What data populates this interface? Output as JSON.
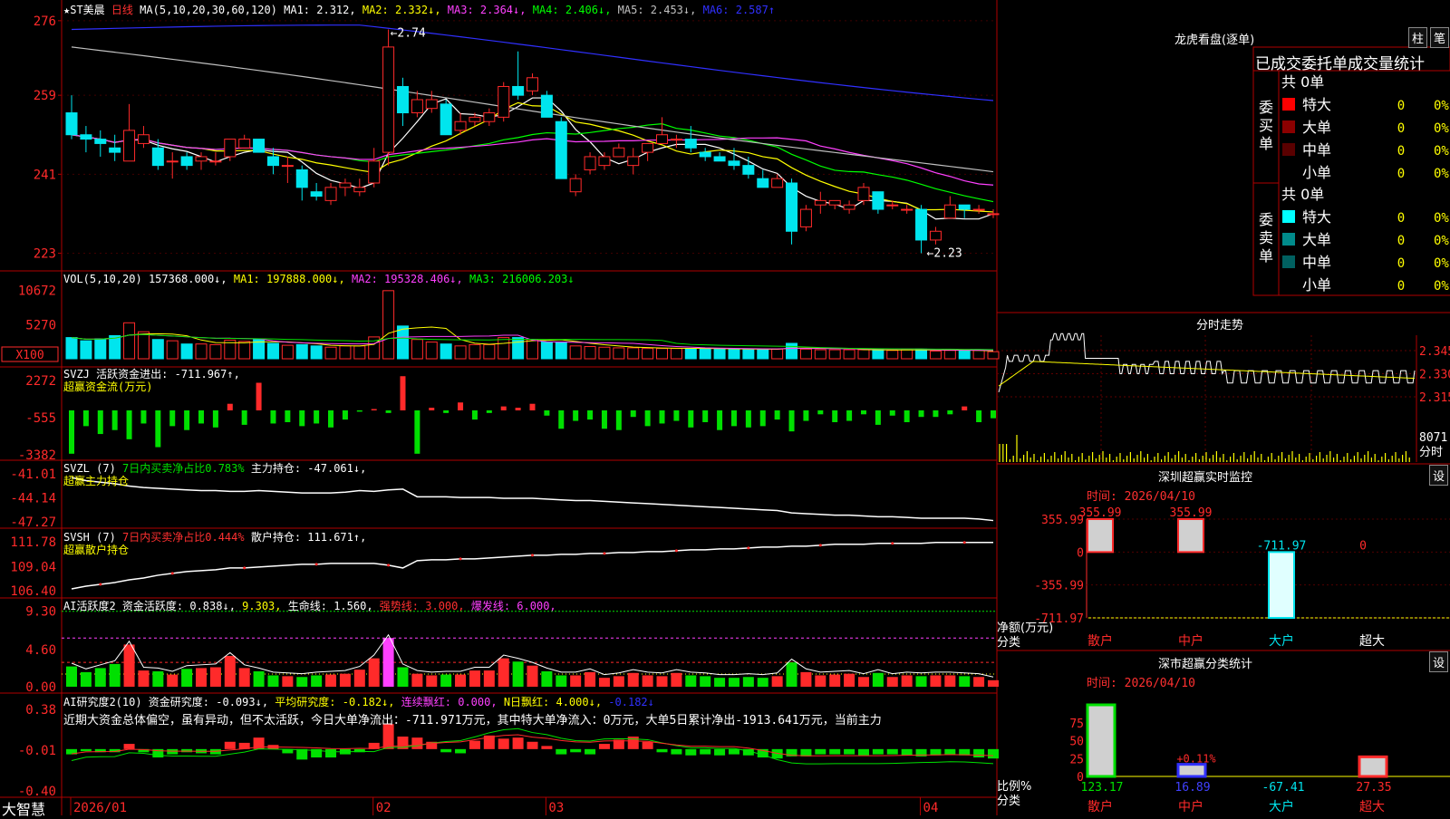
{
  "colors": {
    "up": "#ff2a2a",
    "down": "#00e5ee",
    "grid": "#b00000",
    "ma1": "#ffffff",
    "ma2": "#ffff00",
    "ma3": "#ff40ff",
    "ma4": "#00ff00",
    "ma5": "#c0c0c0",
    "ma6": "#3030ff",
    "green": "#00e000",
    "yellow": "#ffff00",
    "magenta": "#ff40ff",
    "orange": "#ff8040"
  },
  "header": {
    "star": "★",
    "symbol": "ST美晨",
    "period": "日线",
    "ma_label": "MA(5,10,20,30,60,120)",
    "ma1": "MA1: 2.312,",
    "ma2": "MA2: 2.332↓,",
    "ma3": "MA3: 2.364↓,",
    "ma4": "MA4: 2.406↓,",
    "ma5": "MA5: 2.453↓,",
    "ma6": "MA6: 2.587↑"
  },
  "price_axis": [
    "276",
    "259",
    "241",
    "223"
  ],
  "price_annotations": {
    "high": "←2.74",
    "low": "←2.23"
  },
  "vol": {
    "label": "VOL(5,10,20)",
    "value": "157368.000↓,",
    "ma1": "MA1: 197888.000↓,",
    "ma2": "MA2: 195328.406↓,",
    "ma3": "MA3: 216006.203↓",
    "axis": [
      "10672",
      "5270"
    ],
    "unit": "X100"
  },
  "svzj": {
    "label": "SVZJ  活跃资金进出: -711.967↑,",
    "sub": "超赢资金流(万元)",
    "axis": [
      "2272",
      "-555",
      "-3382"
    ]
  },
  "svzl": {
    "label1": "SVZL (7)",
    "label2": "7日内买卖净占比0.783%",
    "label3": "主力持仓: -47.061↓,",
    "sub": "超赢主力持仓",
    "axis": [
      "-41.01",
      "-44.14",
      "-47.27"
    ]
  },
  "svsh": {
    "label1": "SVSH (7)",
    "label2": "7日内买卖净占比0.444%",
    "label3": "散户持仓: 111.671↑,",
    "sub": "超赢散户持仓",
    "axis": [
      "111.78",
      "109.04",
      "106.40"
    ]
  },
  "ai1": {
    "label1": "AI活跃度2 资金活跃度: 0.838↓,",
    "label2": "9.303,",
    "label3": "生命线: 1.560,",
    "label4": "强势线: 3.000,",
    "label5": "爆发线: 6.000,",
    "axis": [
      "9.30",
      "4.60",
      "0.00"
    ]
  },
  "ai2": {
    "label1": "AI研究度2(10) 资金研究度: -0.093↓,",
    "label2": "平均研究度: -0.182↓,",
    "label3": "连续飘红: 0.000,",
    "label4": "N日飘红: 4.000↓,",
    "label5": "-0.182↓",
    "comment": "近期大资金总体偏空，虽有异动，但不太活跃，今日大单净流出：-711.971万元，其中特大单净流入：0万元，大单5日累计净出-1913.641万元，当前主力",
    "axis": [
      "0.38",
      "-0.01",
      "-0.40"
    ]
  },
  "date_axis": [
    "2026/01",
    "02",
    "03",
    "04"
  ],
  "brand": "大智慧",
  "right": {
    "lhb_title": "龙虎看盘(逐单)",
    "tab1": "柱",
    "tab2": "笔",
    "stats_header": "已成交委托单成交量统计",
    "buy_label": "委买单",
    "sell_label": "委卖单",
    "buy_total": "共 0单",
    "sell_total": "共 0单",
    "buy_rows": [
      {
        "name": "特大",
        "qty": "0",
        "pct": "0%",
        "color": "#ff0000"
      },
      {
        "name": "大单",
        "qty": "0",
        "pct": "0%",
        "color": "#8b0000"
      },
      {
        "name": "中单",
        "qty": "0",
        "pct": "0%",
        "color": "#5a0000"
      },
      {
        "name": "小单",
        "qty": "0",
        "pct": "0%",
        "color": ""
      }
    ],
    "sell_rows": [
      {
        "name": "特大",
        "qty": "0",
        "pct": "0%",
        "color": "#00ffff"
      },
      {
        "name": "大单",
        "qty": "0",
        "pct": "0%",
        "color": "#008b8b"
      },
      {
        "name": "中单",
        "qty": "0",
        "pct": "0%",
        "color": "#006060"
      },
      {
        "name": "小单",
        "qty": "0",
        "pct": "0%",
        "color": ""
      }
    ],
    "fs_title": "分时走势",
    "fs_axis": [
      "2.345",
      "2.330",
      "2.315"
    ],
    "fs_vol": "8071",
    "fs_vol_unit": "分时",
    "monitor_title": "深圳超赢实时监控",
    "monitor_btn": "设",
    "monitor_time": "时间: 2026/04/10",
    "monitor_axis": [
      "355.99",
      "0",
      "-355.99",
      "-711.97"
    ],
    "monitor_ylabel": "净额(万元)",
    "monitor_xlabel": "分类",
    "monitor_cats": [
      "散户",
      "中户",
      "大户",
      "超大"
    ],
    "monitor_vals": [
      "355.99",
      "355.99",
      "-711.97",
      "0"
    ],
    "stat_title": "深市超赢分类统计",
    "stat_btn": "设",
    "stat_time": "时间: 2026/04/10",
    "stat_axis": [
      "75",
      "50",
      "25",
      "0"
    ],
    "stat_ylabel": "比例%",
    "stat_xlabel": "分类",
    "stat_cats": [
      "散户",
      "中户",
      "大户",
      "超大"
    ],
    "stat_vals": [
      "123.17",
      "16.89",
      "-67.41",
      "27.35"
    ],
    "stat_note": "+0.11%"
  },
  "chart_data": {
    "type": "bar",
    "title": "ST美晨 日线",
    "candles": [
      {
        "o": 2.55,
        "h": 2.59,
        "l": 2.49,
        "c": 2.5
      },
      {
        "o": 2.5,
        "h": 2.52,
        "l": 2.46,
        "c": 2.49
      },
      {
        "o": 2.49,
        "h": 2.51,
        "l": 2.45,
        "c": 2.48
      },
      {
        "o": 2.47,
        "h": 2.5,
        "l": 2.44,
        "c": 2.46
      },
      {
        "o": 2.44,
        "h": 2.57,
        "l": 2.44,
        "c": 2.51
      },
      {
        "o": 2.48,
        "h": 2.52,
        "l": 2.47,
        "c": 2.5
      },
      {
        "o": 2.47,
        "h": 2.49,
        "l": 2.42,
        "c": 2.43
      },
      {
        "o": 2.44,
        "h": 2.46,
        "l": 2.4,
        "c": 2.44
      },
      {
        "o": 2.45,
        "h": 2.46,
        "l": 2.42,
        "c": 2.43
      },
      {
        "o": 2.44,
        "h": 2.46,
        "l": 2.42,
        "c": 2.45
      },
      {
        "o": 2.44,
        "h": 2.46,
        "l": 2.43,
        "c": 2.44
      },
      {
        "o": 2.45,
        "h": 2.49,
        "l": 2.44,
        "c": 2.49
      },
      {
        "o": 2.47,
        "h": 2.5,
        "l": 2.47,
        "c": 2.49
      },
      {
        "o": 2.49,
        "h": 2.49,
        "l": 2.46,
        "c": 2.46
      },
      {
        "o": 2.45,
        "h": 2.47,
        "l": 2.41,
        "c": 2.43
      },
      {
        "o": 2.43,
        "h": 2.45,
        "l": 2.39,
        "c": 2.43
      },
      {
        "o": 2.42,
        "h": 2.43,
        "l": 2.35,
        "c": 2.38
      },
      {
        "o": 2.37,
        "h": 2.39,
        "l": 2.35,
        "c": 2.36
      },
      {
        "o": 2.35,
        "h": 2.39,
        "l": 2.34,
        "c": 2.38
      },
      {
        "o": 2.38,
        "h": 2.4,
        "l": 2.36,
        "c": 2.39
      },
      {
        "o": 2.37,
        "h": 2.4,
        "l": 2.36,
        "c": 2.38
      },
      {
        "o": 2.39,
        "h": 2.47,
        "l": 2.38,
        "c": 2.44
      },
      {
        "o": 2.46,
        "h": 2.74,
        "l": 2.43,
        "c": 2.7
      },
      {
        "o": 2.61,
        "h": 2.63,
        "l": 2.52,
        "c": 2.55
      },
      {
        "o": 2.55,
        "h": 2.6,
        "l": 2.54,
        "c": 2.58
      },
      {
        "o": 2.56,
        "h": 2.6,
        "l": 2.55,
        "c": 2.58
      },
      {
        "o": 2.57,
        "h": 2.58,
        "l": 2.5,
        "c": 2.5
      },
      {
        "o": 2.51,
        "h": 2.55,
        "l": 2.5,
        "c": 2.53
      },
      {
        "o": 2.53,
        "h": 2.55,
        "l": 2.52,
        "c": 2.54
      },
      {
        "o": 2.53,
        "h": 2.56,
        "l": 2.52,
        "c": 2.55
      },
      {
        "o": 2.54,
        "h": 2.62,
        "l": 2.53,
        "c": 2.61
      },
      {
        "o": 2.61,
        "h": 2.69,
        "l": 2.58,
        "c": 2.59
      },
      {
        "o": 2.6,
        "h": 2.64,
        "l": 2.59,
        "c": 2.63
      },
      {
        "o": 2.59,
        "h": 2.6,
        "l": 2.54,
        "c": 2.54
      },
      {
        "o": 2.53,
        "h": 2.54,
        "l": 2.4,
        "c": 2.4
      },
      {
        "o": 2.37,
        "h": 2.41,
        "l": 2.36,
        "c": 2.4
      },
      {
        "o": 2.42,
        "h": 2.46,
        "l": 2.41,
        "c": 2.45
      },
      {
        "o": 2.43,
        "h": 2.46,
        "l": 2.42,
        "c": 2.45
      },
      {
        "o": 2.45,
        "h": 2.48,
        "l": 2.45,
        "c": 2.47
      },
      {
        "o": 2.43,
        "h": 2.47,
        "l": 2.41,
        "c": 2.45
      },
      {
        "o": 2.46,
        "h": 2.48,
        "l": 2.44,
        "c": 2.48
      },
      {
        "o": 2.48,
        "h": 2.54,
        "l": 2.48,
        "c": 2.5
      },
      {
        "o": 2.49,
        "h": 2.5,
        "l": 2.47,
        "c": 2.49
      },
      {
        "o": 2.49,
        "h": 2.52,
        "l": 2.46,
        "c": 2.47
      },
      {
        "o": 2.46,
        "h": 2.47,
        "l": 2.44,
        "c": 2.45
      },
      {
        "o": 2.45,
        "h": 2.46,
        "l": 2.44,
        "c": 2.44
      },
      {
        "o": 2.44,
        "h": 2.47,
        "l": 2.42,
        "c": 2.43
      },
      {
        "o": 2.43,
        "h": 2.45,
        "l": 2.4,
        "c": 2.41
      },
      {
        "o": 2.4,
        "h": 2.42,
        "l": 2.38,
        "c": 2.38
      },
      {
        "o": 2.38,
        "h": 2.41,
        "l": 2.38,
        "c": 2.4
      },
      {
        "o": 2.39,
        "h": 2.4,
        "l": 2.25,
        "c": 2.28
      },
      {
        "o": 2.29,
        "h": 2.34,
        "l": 2.28,
        "c": 2.33
      },
      {
        "o": 2.34,
        "h": 2.37,
        "l": 2.32,
        "c": 2.35
      },
      {
        "o": 2.34,
        "h": 2.35,
        "l": 2.33,
        "c": 2.35
      },
      {
        "o": 2.33,
        "h": 2.35,
        "l": 2.32,
        "c": 2.34
      },
      {
        "o": 2.35,
        "h": 2.39,
        "l": 2.34,
        "c": 2.38
      },
      {
        "o": 2.37,
        "h": 2.37,
        "l": 2.32,
        "c": 2.33
      },
      {
        "o": 2.34,
        "h": 2.35,
        "l": 2.33,
        "c": 2.34
      },
      {
        "o": 2.33,
        "h": 2.34,
        "l": 2.32,
        "c": 2.33
      },
      {
        "o": 2.33,
        "h": 2.34,
        "l": 2.23,
        "c": 2.26
      },
      {
        "o": 2.26,
        "h": 2.29,
        "l": 2.25,
        "c": 2.28
      },
      {
        "o": 2.31,
        "h": 2.36,
        "l": 2.31,
        "c": 2.34
      },
      {
        "o": 2.34,
        "h": 2.34,
        "l": 2.31,
        "c": 2.33
      },
      {
        "o": 2.33,
        "h": 2.34,
        "l": 2.32,
        "c": 2.33
      },
      {
        "o": 2.32,
        "h": 2.33,
        "l": 2.31,
        "c": 2.32
      }
    ],
    "volumes": [
      3.3,
      2.8,
      3.1,
      3.6,
      5.6,
      4.2,
      3.0,
      2.8,
      2.3,
      2.3,
      2.2,
      2.9,
      2.7,
      3.0,
      2.4,
      2.1,
      2.2,
      2.0,
      1.8,
      2.0,
      2.0,
      3.4,
      10.6,
      5.1,
      3.0,
      2.6,
      2.3,
      2.0,
      2.2,
      2.2,
      3.3,
      3.3,
      3.0,
      2.6,
      2.6,
      2.0,
      1.9,
      1.8,
      1.7,
      1.7,
      1.6,
      1.6,
      1.6,
      1.6,
      1.6,
      1.5,
      1.5,
      1.4,
      1.5,
      1.5,
      2.4,
      1.5,
      1.4,
      1.4,
      1.4,
      1.4,
      1.4,
      1.3,
      1.4,
      1.5,
      1.2,
      1.3,
      1.2,
      1.3,
      1.1
    ],
    "svzj": [
      -3300,
      -1200,
      -1800,
      -1500,
      -2200,
      -1000,
      -2800,
      -1200,
      -1500,
      -1000,
      -1300,
      500,
      -1100,
      2100,
      -1000,
      -900,
      -1200,
      -1000,
      -1300,
      -700,
      -100,
      100,
      -200,
      2600,
      -3300,
      200,
      -200,
      600,
      -700,
      -200,
      300,
      200,
      500,
      -400,
      -1400,
      -800,
      -700,
      -1400,
      -1500,
      -500,
      -1200,
      -1000,
      -800,
      -1300,
      -900,
      -1500,
      -1200,
      -1300,
      -1200,
      -700,
      -1600,
      -800,
      -300,
      -900,
      -800,
      -300,
      -1100,
      -400,
      -900,
      -500,
      -500,
      -300,
      300,
      -900,
      -600
    ],
    "svzl": [
      -41.5,
      -41.9,
      -42.1,
      -42.3,
      -42.6,
      -42.8,
      -42.9,
      -43.0,
      -43.1,
      -43.2,
      -43.2,
      -43.3,
      -43.3,
      -43.2,
      -43.3,
      -43.4,
      -43.5,
      -43.5,
      -43.5,
      -43.4,
      -43.2,
      -43.3,
      -43.1,
      -43.0,
      -44.0,
      -44.0,
      -44.0,
      -44.1,
      -44.1,
      -44.1,
      -44.2,
      -44.2,
      -44.2,
      -44.3,
      -44.4,
      -44.5,
      -44.5,
      -44.6,
      -44.7,
      -44.8,
      -44.9,
      -45.0,
      -45.1,
      -45.2,
      -45.3,
      -45.4,
      -45.5,
      -45.6,
      -45.7,
      -45.8,
      -46.1,
      -46.2,
      -46.3,
      -46.4,
      -46.4,
      -46.5,
      -46.6,
      -46.6,
      -46.7,
      -46.8,
      -46.8,
      -46.8,
      -46.8,
      -46.9,
      -47.1
    ],
    "svsh": [
      106.6,
      106.9,
      107.1,
      107.3,
      107.6,
      107.8,
      108.1,
      108.3,
      108.5,
      108.6,
      108.7,
      108.9,
      108.9,
      109.0,
      109.1,
      109.2,
      109.3,
      109.3,
      109.4,
      109.4,
      109.4,
      109.4,
      109.2,
      108.9,
      109.7,
      109.8,
      109.8,
      109.9,
      109.9,
      110.0,
      110.1,
      110.2,
      110.3,
      110.3,
      110.4,
      110.4,
      110.5,
      110.5,
      110.6,
      110.6,
      110.7,
      110.7,
      110.8,
      110.9,
      110.9,
      111.0,
      111.0,
      111.1,
      111.2,
      111.2,
      111.3,
      111.3,
      111.4,
      111.5,
      111.5,
      111.5,
      111.6,
      111.6,
      111.6,
      111.6,
      111.7,
      111.7,
      111.7,
      111.7,
      111.7
    ],
    "ai1": [
      2.5,
      1.8,
      2.3,
      2.8,
      5.2,
      2.0,
      1.9,
      1.5,
      2.2,
      2.3,
      2.4,
      3.8,
      2.3,
      1.9,
      1.4,
      1.3,
      1.2,
      1.4,
      1.5,
      1.6,
      2.1,
      3.5,
      6.0,
      2.4,
      1.6,
      1.4,
      1.5,
      1.5,
      2.0,
      2.0,
      3.5,
      3.1,
      2.6,
      1.9,
      1.4,
      1.4,
      1.8,
      1.1,
      1.3,
      1.7,
      1.4,
      1.3,
      1.7,
      1.4,
      1.3,
      1.1,
      1.1,
      1.2,
      1.1,
      1.3,
      3.0,
      1.8,
      1.4,
      1.5,
      1.6,
      1.2,
      1.7,
      1.2,
      1.4,
      1.3,
      1.4,
      1.4,
      1.3,
      1.2,
      0.8
    ],
    "ai2": [
      -0.05,
      -0.02,
      -0.03,
      -0.03,
      0.05,
      -0.03,
      -0.08,
      -0.05,
      -0.03,
      -0.04,
      -0.05,
      0.07,
      0.06,
      0.11,
      0.04,
      -0.04,
      -0.1,
      -0.08,
      -0.08,
      -0.05,
      -0.03,
      0.06,
      0.24,
      0.12,
      0.11,
      0.07,
      -0.03,
      -0.04,
      0.08,
      0.13,
      0.1,
      0.11,
      0.07,
      0.03,
      -0.05,
      -0.03,
      -0.05,
      0.05,
      0.09,
      0.12,
      0.07,
      -0.03,
      -0.05,
      -0.06,
      -0.05,
      -0.06,
      -0.05,
      -0.06,
      -0.08,
      -0.09,
      -0.07,
      -0.07,
      -0.05,
      -0.05,
      -0.05,
      -0.06,
      -0.05,
      -0.05,
      -0.06,
      -0.07,
      -0.06,
      -0.05,
      -0.06,
      -0.08,
      -0.09
    ],
    "ylim": [
      2.2,
      2.77
    ],
    "x_labels": [
      "2026/01",
      "02",
      "03",
      "04"
    ]
  }
}
